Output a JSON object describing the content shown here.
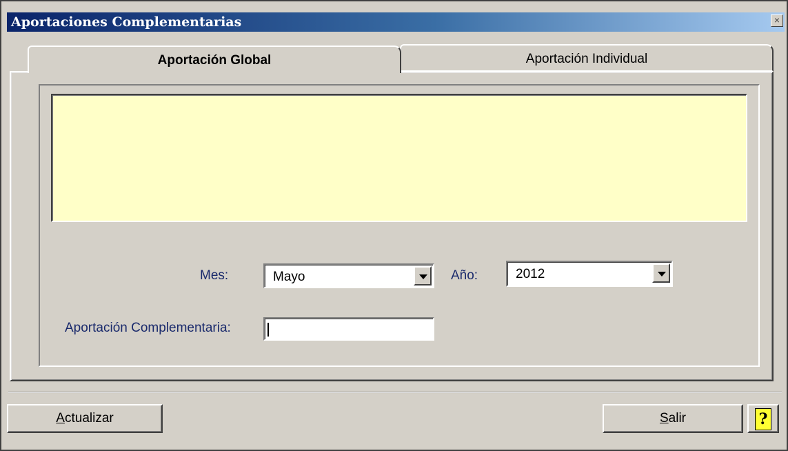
{
  "window": {
    "title": "Aportaciones Complementarias",
    "close_label": "×"
  },
  "tabs": [
    {
      "label": "Aportación Global",
      "active": true
    },
    {
      "label": "Aportación Individual",
      "active": false
    }
  ],
  "form": {
    "mes_label": "Mes:",
    "mes_value": "Mayo",
    "anio_label": "Año:",
    "anio_value": "2012",
    "aportacion_label": "Aportación Complementaria:",
    "aportacion_value": ""
  },
  "buttons": {
    "actualizar_hotkey": "A",
    "actualizar_rest": "ctualizar",
    "salir_hotkey": "S",
    "salir_rest": "alir",
    "help_label": "?"
  },
  "colors": {
    "face": "#d4d0c8",
    "info_area": "#ffffc8",
    "title_start": "#0a246a",
    "label_text": "#1a2a6c"
  }
}
